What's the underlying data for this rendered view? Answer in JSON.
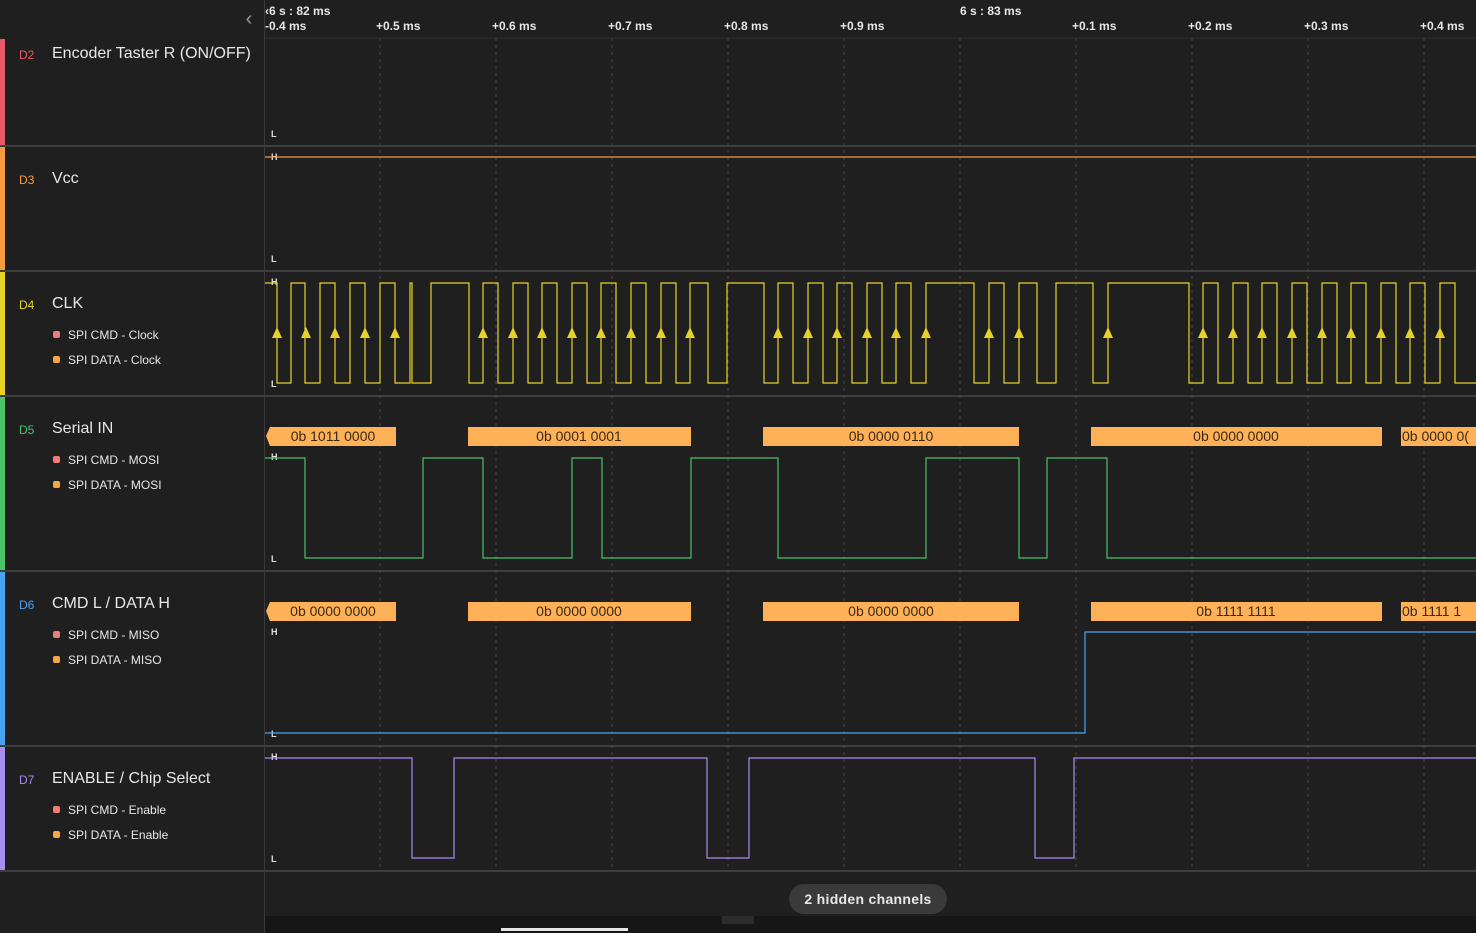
{
  "time_header": {
    "segments": [
      "6 s : 82 ms",
      "6 s : 83 ms"
    ],
    "segment_prefix": "‹",
    "ticks": [
      "-0.4 ms",
      "+0.5 ms",
      "+0.6 ms",
      "+0.7 ms",
      "+0.8 ms",
      "+0.9 ms",
      "+0.1 ms",
      "+0.2 ms",
      "+0.3 ms",
      "+0.4 ms"
    ],
    "collapse_icon": "chevron-left-icon"
  },
  "channels": [
    {
      "id": "D2",
      "name": "Encoder Taster R (ON/OFF)",
      "color": "#e85a6b",
      "analyzers": [],
      "levels": [
        "L"
      ]
    },
    {
      "id": "D3",
      "name": "Vcc",
      "color": "#f59b42",
      "analyzers": [],
      "levels": [
        "H",
        "L"
      ]
    },
    {
      "id": "D4",
      "name": "CLK",
      "color": "#e8d22a",
      "analyzers": [
        "SPI CMD - Clock",
        "SPI DATA - Clock"
      ],
      "levels": [
        "H",
        "L"
      ]
    },
    {
      "id": "D5",
      "name": "Serial IN",
      "color": "#4cc16a",
      "analyzers": [
        "SPI CMD - MOSI",
        "SPI DATA - MOSI"
      ],
      "levels": [
        "H",
        "L"
      ],
      "decoded": [
        "0b 1011 0000",
        "0b 0001 0001",
        "0b 0000 0110",
        "0b 0000 0000",
        "0b 0000 0("
      ]
    },
    {
      "id": "D6",
      "name": "CMD L / DATA H",
      "color": "#4aa3f0",
      "analyzers": [
        "SPI CMD - MISO",
        "SPI DATA - MISO"
      ],
      "levels": [
        "H",
        "L"
      ],
      "decoded": [
        "0b 0000 0000",
        "0b 0000 0000",
        "0b 0000 0000",
        "0b 1111 1111",
        "0b 1111 1"
      ]
    },
    {
      "id": "D7",
      "name": "ENABLE / Chip Select",
      "color": "#a78bf0",
      "analyzers": [
        "SPI CMD - Enable",
        "SPI DATA - Enable"
      ],
      "levels": [
        "H",
        "L"
      ]
    }
  ],
  "analyzer_colors": {
    "cmd": "#f07b7b",
    "data": "#f5a742"
  },
  "decoded_fill": "#ffb158",
  "hidden_channels_label": "2 hidden channels"
}
